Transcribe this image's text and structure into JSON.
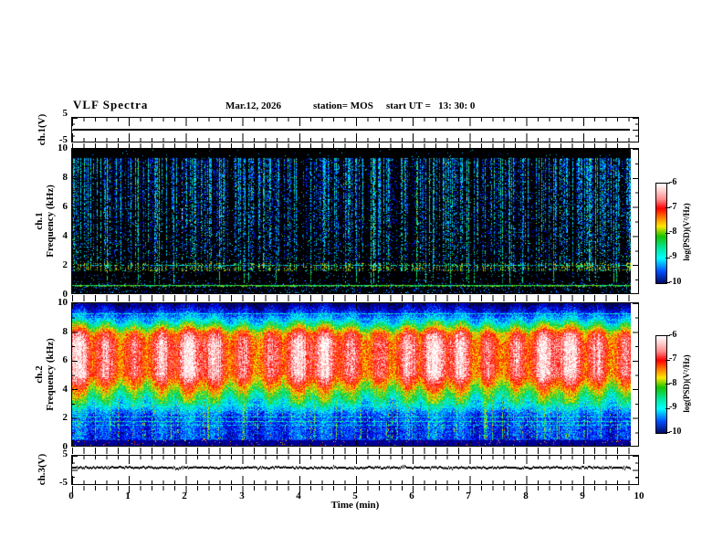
{
  "header": {
    "title": "VLF Spectra",
    "date": "Mar.12, 2026",
    "station": "station= MOS",
    "start_ut": "start UT =   13: 30: 0"
  },
  "xaxis": {
    "label": "Time (min)",
    "ticks": [
      "0",
      "1",
      "2",
      "3",
      "4",
      "5",
      "6",
      "7",
      "8",
      "9",
      "10"
    ]
  },
  "panels": {
    "ch1v": {
      "label": "ch.1(V)",
      "yticks": [
        "5",
        "-5"
      ]
    },
    "spec1": {
      "label_ch": "ch.1",
      "label_axis": "Frequency (kHz)",
      "yticks": [
        "10",
        "8",
        "6",
        "4",
        "2",
        "0"
      ]
    },
    "spec2": {
      "label_ch": "ch.2",
      "label_axis": "Frequency (kHz)",
      "yticks": [
        "10",
        "8",
        "6",
        "4",
        "2",
        "0"
      ]
    },
    "ch3v": {
      "label": "ch.3(V)",
      "yticks": [
        "5",
        "-5"
      ]
    }
  },
  "colorbars": {
    "label": "log(PSD)(V²/Hz)",
    "ticks": [
      "-6",
      "-7",
      "-8",
      "-9",
      "-10"
    ]
  },
  "chart_data": [
    {
      "id": "ch1_voltage_trace",
      "type": "line",
      "ylabel": "ch.1(V)",
      "ylim": [
        -5,
        5
      ],
      "xlim": [
        0,
        10
      ],
      "x_extent_min": [
        0,
        9.85
      ],
      "signal": "flat trace at 0 V for the whole record",
      "render": {
        "value": 0,
        "thickness": 2
      }
    },
    {
      "id": "ch1_spectrogram",
      "type": "heatmap",
      "ylabel": "ch.1 Frequency (kHz)",
      "ylim": [
        0,
        10
      ],
      "xlim": [
        0,
        10
      ],
      "x_extent_min": [
        0,
        9.85
      ],
      "zlabel": "log(PSD)(V²/Hz)",
      "zlim": [
        -10,
        -6
      ],
      "colormap": "jet with white top",
      "features": {
        "background_level": -10,
        "description": "dense broadband impulsive vertical streaks from ~1.6 to ~9.4 kHz, mostly blue/cyan (-9.5..-8), occasional green/red strong impulses; black band above 9.4 kHz; quiet dark band 0.7-1.5 kHz; persistent horizontal carrier lines near 1.95 kHz (dotted cyan) and 0.55 kHz (solid cyan-green)"
      },
      "render": {
        "seed": 12345,
        "streak_prob": 0.52,
        "strong_prob": 0.045,
        "red_prob": 0.02,
        "top_black_khz": 9.42,
        "dark_band_top_khz": 1.55,
        "hlines": [
          {
            "f": 1.95,
            "v": -9.0,
            "density": 0.45,
            "thick": false
          },
          {
            "f": 0.55,
            "v": -8.4,
            "density": 1.0,
            "thick": true
          }
        ]
      }
    },
    {
      "id": "ch2_spectrogram",
      "type": "heatmap",
      "ylabel": "ch.2 Frequency (kHz)",
      "ylim": [
        0,
        10
      ],
      "xlim": [
        0,
        10
      ],
      "x_extent_min": [
        0,
        9.85
      ],
      "zlabel": "log(PSD)(V²/Hz)",
      "zlim": [
        -10,
        -6
      ],
      "colormap": "jet with white top",
      "features": {
        "description": "intense red/orange band ~4.5-8 kHz (-6.5..-7) pulsing in time, yellow-green transition 3-4.5 kHz, blue 9-10 kHz and below 2.3 kHz, cyan vertical streaks reaching down to 0.5 kHz, horizontal cyan lines near 9.3, 2.05, 1.75 and 1.5 kHz, very dark band below 0.4 kHz with sparse bright specks"
      },
      "render": {
        "seed": 99173,
        "streak_prob": 0.38,
        "strong_streak_prob": 0.05,
        "mod_weight": 1.25,
        "noise": 0.85,
        "profile": [
          [
            0,
            -9.85
          ],
          [
            0.3,
            -9.75
          ],
          [
            0.5,
            -9.35
          ],
          [
            2.1,
            -9.25
          ],
          [
            2.4,
            -9.0
          ],
          [
            3.0,
            -8.4
          ],
          [
            3.6,
            -7.9
          ],
          [
            4.4,
            -7.1
          ],
          [
            5.0,
            -6.6
          ],
          [
            7.2,
            -6.55
          ],
          [
            7.9,
            -6.9
          ],
          [
            8.4,
            -7.9
          ],
          [
            8.9,
            -8.8
          ],
          [
            9.55,
            -9.5
          ],
          [
            10,
            -9.9
          ]
        ],
        "hlines": [
          {
            "f": 9.3,
            "v": -8.8,
            "density": 0.85
          },
          {
            "f": 2.05,
            "v": -8.8,
            "density": 0.7
          },
          {
            "f": 1.75,
            "v": -8.7,
            "density": 0.8
          },
          {
            "f": 1.5,
            "v": -8.9,
            "density": 0.6
          }
        ]
      }
    },
    {
      "id": "ch3_voltage_trace",
      "type": "line",
      "ylabel": "ch.3(V)",
      "ylim": [
        -5,
        5
      ],
      "xlim": [
        0,
        10
      ],
      "x_extent_min": [
        0,
        9.85
      ],
      "signal": "near 0 V with small noise and occasional tiny spikes",
      "render": {
        "seed": 555,
        "jitter": 1.6,
        "spike_prob": 0.05
      }
    }
  ]
}
